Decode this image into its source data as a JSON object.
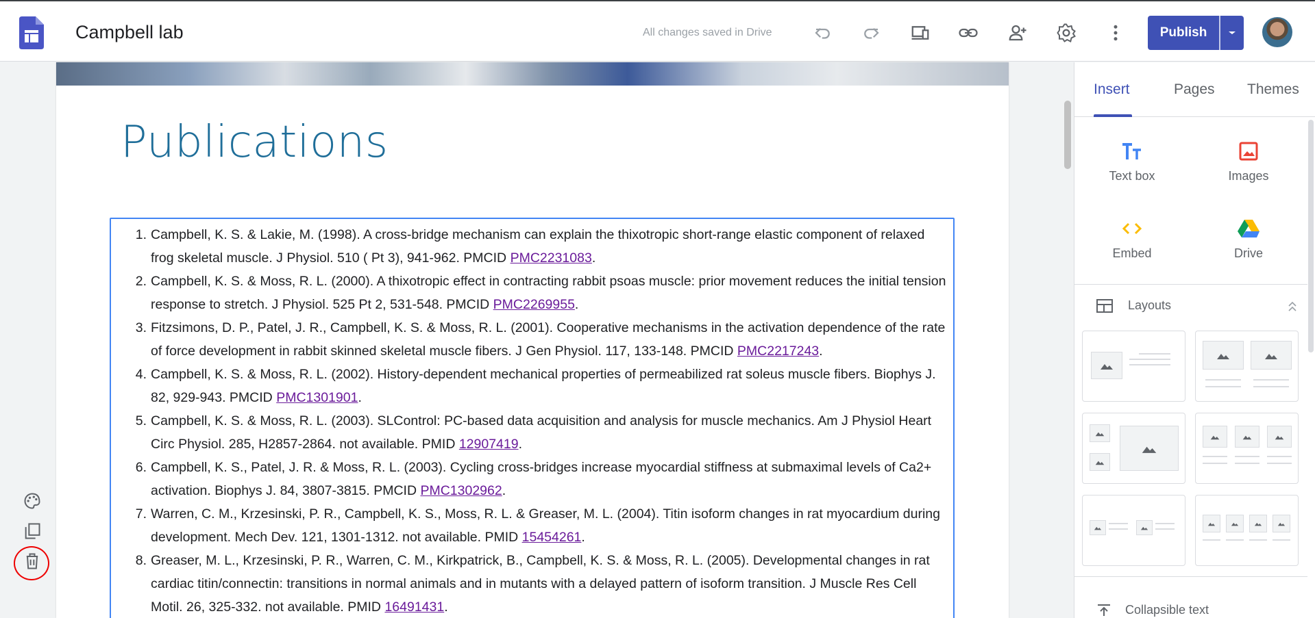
{
  "header": {
    "title": "Campbell lab",
    "save_status": "All changes saved in Drive",
    "publish_label": "Publish"
  },
  "icons": [
    "sites-logo-icon",
    "undo-icon",
    "redo-icon",
    "preview-icon",
    "link-icon",
    "share-icon",
    "settings-icon",
    "more-icon",
    "avatar",
    "palette-icon",
    "duplicate-icon",
    "delete-icon"
  ],
  "page": {
    "heading": "Publications",
    "publications": [
      {
        "num": "1.",
        "text": "Campbell, K. S. & Lakie, M. (1998). A cross-bridge mechanism can explain the thixotropic short-range elastic component of relaxed frog skeletal muscle. J Physiol. 510 ( Pt 3), 941-962. PMCID ",
        "link": "PMC2231083",
        "end": "."
      },
      {
        "num": "2.",
        "text": "Campbell, K. S. & Moss, R. L. (2000). A thixotropic effect in contracting rabbit psoas muscle: prior movement reduces the initial tension response to stretch. J Physiol. 525 Pt 2, 531-548. PMCID ",
        "link": "PMC2269955",
        "end": "."
      },
      {
        "num": "3.",
        "text": "Fitzsimons, D. P., Patel, J. R., Campbell, K. S. & Moss, R. L. (2001). Cooperative mechanisms in the activation dependence of the rate of force development in rabbit skinned skeletal muscle fibers. J Gen Physiol. 117, 133-148. PMCID ",
        "link": "PMC2217243",
        "end": "."
      },
      {
        "num": "4.",
        "text": "Campbell, K. S. & Moss, R. L. (2002). History-dependent mechanical properties of permeabilized rat soleus muscle fibers. Biophys J. 82, 929-943. PMCID ",
        "link": "PMC1301901",
        "end": "."
      },
      {
        "num": "5.",
        "text": "Campbell, K. S. & Moss, R. L. (2003). SLControl: PC-based data acquisition and analysis for muscle mechanics. Am J Physiol Heart Circ Physiol. 285, H2857-2864. not available. PMID ",
        "link": "12907419",
        "end": "."
      },
      {
        "num": "6.",
        "text": "Campbell, K. S., Patel, J. R. & Moss, R. L. (2003). Cycling cross-bridges increase myocardial stiffness at submaximal levels of Ca2+ activation. Biophys J. 84, 3807-3815. PMCID ",
        "link": "PMC1302962",
        "end": "."
      },
      {
        "num": "7.",
        "text": "Warren, C. M., Krzesinski, P. R., Campbell, K. S., Moss, R. L. & Greaser, M. L. (2004). Titin isoform changes in rat myocardium during development. Mech Dev. 121, 1301-1312. not available. PMID ",
        "link": "15454261",
        "end": "."
      },
      {
        "num": "8.",
        "text": "Greaser, M. L., Krzesinski, P. R., Warren, C. M., Kirkpatrick, B., Campbell, K. S. & Moss, R. L. (2005). Developmental changes in rat cardiac titin/connectin: transitions in normal animals and in mutants with a delayed pattern of isoform transition. J Muscle Res Cell Motil. 26, 325-332. not available. PMID ",
        "link": "16491431",
        "end": "."
      }
    ]
  },
  "panel": {
    "tabs": [
      "Insert",
      "Pages",
      "Themes"
    ],
    "active_tab": "Insert",
    "insert_items": [
      "Text box",
      "Images",
      "Embed",
      "Drive"
    ],
    "layouts_label": "Layouts",
    "collapsible_label": "Collapsible text"
  },
  "colors": {
    "accent": "#3f51b5",
    "heading": "#1f6e99",
    "link": "#6a1b9a",
    "selection": "#4285f4"
  }
}
